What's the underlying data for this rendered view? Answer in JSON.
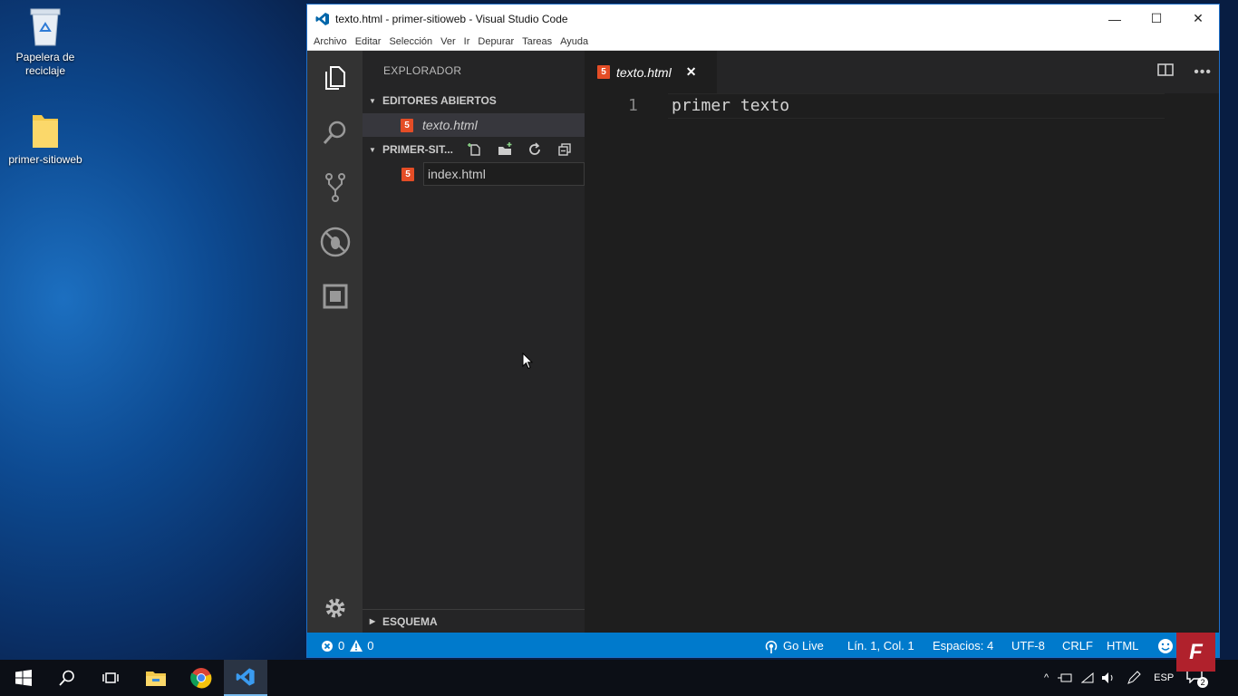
{
  "desktop": {
    "icons": [
      {
        "label": "Papelera de reciclaje",
        "icon": "recycle-bin-icon"
      },
      {
        "label": "primer-sitioweb",
        "icon": "folder-icon"
      }
    ]
  },
  "window": {
    "title": "texto.html - primer-sitioweb - Visual Studio Code",
    "controls": [
      "minimize",
      "maximize",
      "close"
    ]
  },
  "menubar": {
    "items": [
      "Archivo",
      "Editar",
      "Selección",
      "Ver",
      "Ir",
      "Depurar",
      "Tareas",
      "Ayuda"
    ]
  },
  "activity_bar": {
    "items": [
      "explorer-icon",
      "search-icon",
      "source-control-icon",
      "debug-icon",
      "extensions-icon"
    ],
    "bottom": "settings-gear-icon"
  },
  "sidebar": {
    "title": "EXPLORADOR",
    "open_editors": {
      "label": "EDITORES ABIERTOS",
      "files": [
        "texto.html"
      ]
    },
    "folder": {
      "label": "PRIMER-SIT...",
      "actions": [
        "new-file-icon",
        "new-folder-icon",
        "refresh-icon",
        "collapse-all-icon"
      ],
      "files": [
        "index.html"
      ]
    },
    "outline": {
      "label": "ESQUEMA"
    }
  },
  "editor": {
    "tab": {
      "name": "texto.html",
      "close": "✕"
    },
    "lines": [
      {
        "number": "1",
        "text": "primer texto"
      }
    ]
  },
  "statusbar": {
    "errors": "0",
    "warnings": "0",
    "go_live": "Go Live",
    "position": "Lín. 1, Col. 1",
    "spaces": "Espacios: 4",
    "encoding": "UTF-8",
    "eol": "CRLF",
    "language": "HTML"
  },
  "taskbar": {
    "items": [
      "windows-start-icon",
      "search-icon",
      "task-view-icon",
      "file-explorer-icon",
      "chrome-icon",
      "vscode-icon"
    ],
    "tray": {
      "language": "ESP",
      "notifications": "2"
    }
  },
  "watermark": {
    "letter": "F"
  },
  "colors": {
    "accent": "#007acc",
    "html_icon": "#e44d26",
    "editor_bg": "#1e1e1e",
    "sidebar_bg": "#252526"
  }
}
